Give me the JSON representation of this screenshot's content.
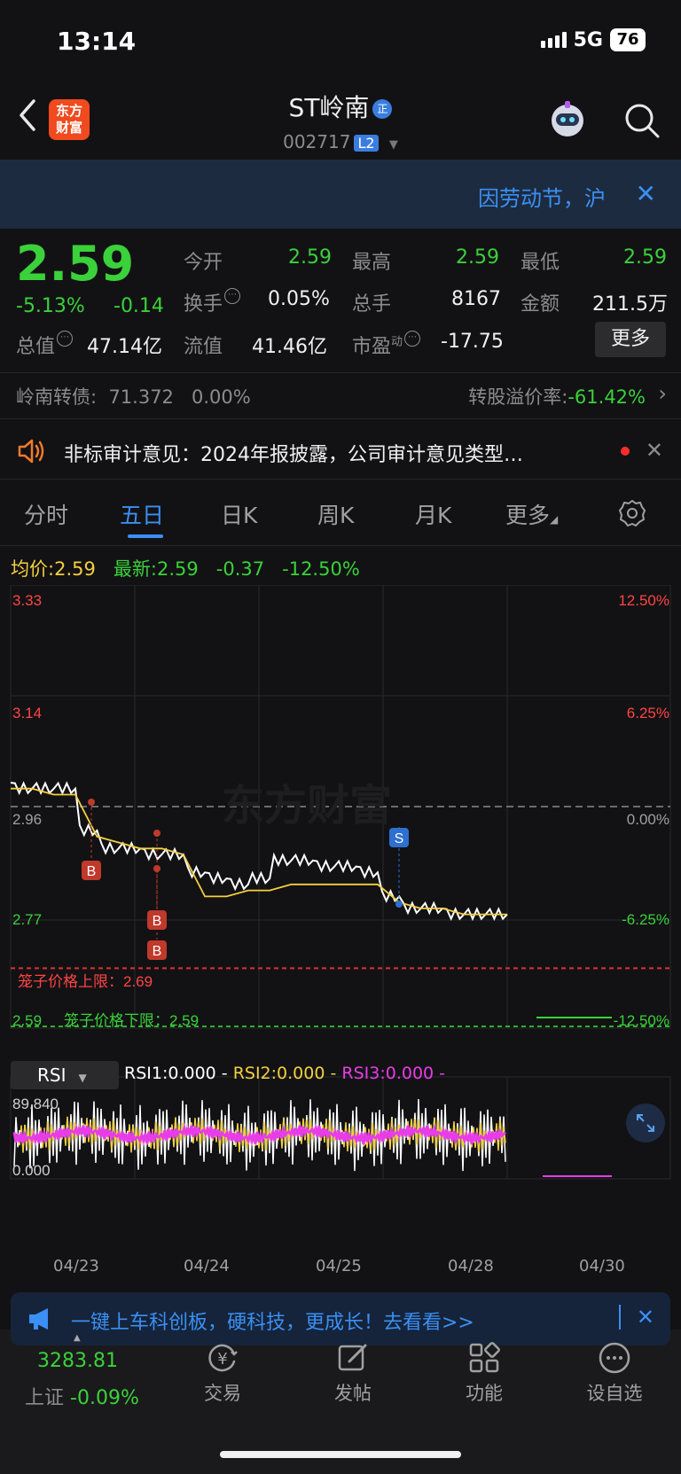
{
  "status_bar": {
    "time": "13:14",
    "network": "5G",
    "battery": "76"
  },
  "header": {
    "logo_line1": "东方",
    "logo_line2": "财富",
    "stock_name": "ST岭南",
    "stock_badge": "正",
    "stock_code": "002717",
    "level": "L2"
  },
  "banner": {
    "text": "因劳动节，沪",
    "close": "✕"
  },
  "quote": {
    "price": "2.59",
    "change_pct": "-5.13%",
    "change_abs": "-0.14",
    "open_label": "今开",
    "open_value": "2.59",
    "high_label": "最高",
    "high_value": "2.59",
    "low_label": "最低",
    "low_value": "2.59",
    "turnover_label": "换手",
    "turnover_value": "0.05%",
    "volume_label": "总手",
    "volume_value": "8167",
    "amount_label": "金额",
    "amount_value": "211.5万",
    "mktcap_label": "总值",
    "mktcap_value": "47.14亿",
    "float_label": "流值",
    "float_value": "41.46亿",
    "pe_label": "市盈",
    "pe_sup": "动",
    "pe_value": "-17.75",
    "more_label": "更多"
  },
  "convertible": {
    "label": "岭南转债:",
    "price": "71.372",
    "pct": "0.00%",
    "premium_label": "转股溢价率:",
    "premium_value": "-61.42%"
  },
  "news": {
    "text": "非标审计意见：2024年报披露，公司审计意见类型…"
  },
  "tabs": [
    "分时",
    "五日",
    "日K",
    "周K",
    "月K",
    "更多"
  ],
  "avg_line": {
    "avg_label": "均价:",
    "avg_value": "2.59",
    "latest_label": "最新:",
    "latest_value": "2.59",
    "chg": "-0.37",
    "chg_pct": "-12.50%"
  },
  "chart_data": {
    "type": "line",
    "title": "",
    "x": [
      "04/23",
      "04/24",
      "04/25",
      "04/28",
      "04/30"
    ],
    "y_axis_left": [
      "3.33",
      "3.14",
      "2.96",
      "2.77",
      "2.59"
    ],
    "y_axis_right": [
      "12.50%",
      "6.25%",
      "0.00%",
      "-6.25%",
      "-12.50%"
    ],
    "ylim": [
      2.59,
      3.33
    ],
    "prev_close": 2.96,
    "series": [
      {
        "name": "",
        "color": "#ffffff",
        "values": [
          3.0,
          2.99,
          2.99,
          2.99,
          2.92,
          2.89,
          2.89,
          2.88,
          2.88,
          2.85,
          2.84,
          2.83,
          2.84,
          2.87,
          2.87,
          2.86,
          2.86,
          2.85,
          2.81,
          2.79,
          2.79,
          2.78,
          2.78,
          2.78
        ]
      },
      {
        "name": "",
        "color": "#f4d03f",
        "values": [
          2.99,
          2.99,
          2.98,
          2.98,
          2.91,
          2.9,
          2.89,
          2.89,
          2.88,
          2.81,
          2.81,
          2.82,
          2.82,
          2.83,
          2.83,
          2.83,
          2.83,
          2.83,
          2.8,
          2.79,
          2.79,
          2.78,
          2.78,
          2.78
        ]
      }
    ],
    "markers": [
      {
        "label": "B",
        "day": "04/23"
      },
      {
        "label": "B",
        "day": "04/24"
      },
      {
        "label": "B",
        "day": "04/24"
      },
      {
        "label": "S",
        "day": "04/25"
      }
    ],
    "upper_limit_label": "笼子价格上限：2.69",
    "lower_limit_label": "笼子价格下限：2.59",
    "watermark": "东方财富"
  },
  "rsi": {
    "tab_label": "RSI",
    "rsi1": "RSI1:0.000",
    "rsi2": "RSI2:0.000",
    "rsi3": "RSI3:0.000",
    "y_max": "89.840",
    "y_min": "0.000",
    "colors": {
      "rsi1": "#ffffff",
      "rsi2": "#f4d03f",
      "rsi3": "#e83ce8"
    }
  },
  "promo": {
    "text": "一键上车科创板，硬科技，更成长！去看看>>"
  },
  "bottom_nav": {
    "index_value": "3283.81",
    "index_name": "上证",
    "index_chg": "-0.09%",
    "items": [
      "交易",
      "发帖",
      "功能",
      "设自选"
    ]
  }
}
